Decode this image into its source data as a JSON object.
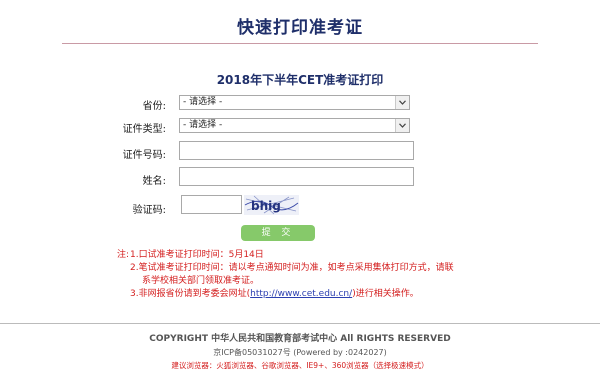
{
  "header": {
    "title": "快速打印准考证"
  },
  "form": {
    "title": "2018年下半年CET准考证打印",
    "province": {
      "label": "省份:",
      "selected": "- 请选择 -"
    },
    "cert_type": {
      "label": "证件类型:",
      "selected": "- 请选择 -"
    },
    "cert_number": {
      "label": "证件号码:",
      "value": ""
    },
    "name": {
      "label": "姓名:",
      "value": ""
    },
    "captcha": {
      "label": "验证码:",
      "value": "",
      "image_text": "bhig"
    },
    "submit_label": "提 交"
  },
  "notes": {
    "prefix": "注:",
    "line1": "1.口试准考证打印时间：5月14日",
    "line2a": "2.笔试准考证打印时间：请以考点通知时间为准，如考点采用集体打印方式，请联",
    "line2b": "系学校相关部门领取准考证。",
    "line3_before": "3.非网报省份请到考委会网址(",
    "line3_link": "http://www.cet.edu.cn/",
    "line3_after": ")进行相关操作。"
  },
  "footer": {
    "copyright": "COPYRIGHT 中华人民共和国教育部考试中心 All RIGHTS RESERVED",
    "icp": "京ICP备05031027号 (Powered by :0242027)",
    "browser_note": "建议浏览器：火狐浏览器、谷歌浏览器、IE9+、360浏览器（选择极速模式）"
  },
  "colors": {
    "title": "#1f2f6a",
    "accent_red": "#d42020",
    "submit_green": "#86c96a",
    "link": "#2b3fb0"
  },
  "icons": {
    "dropdown": "chevron-down-icon"
  }
}
